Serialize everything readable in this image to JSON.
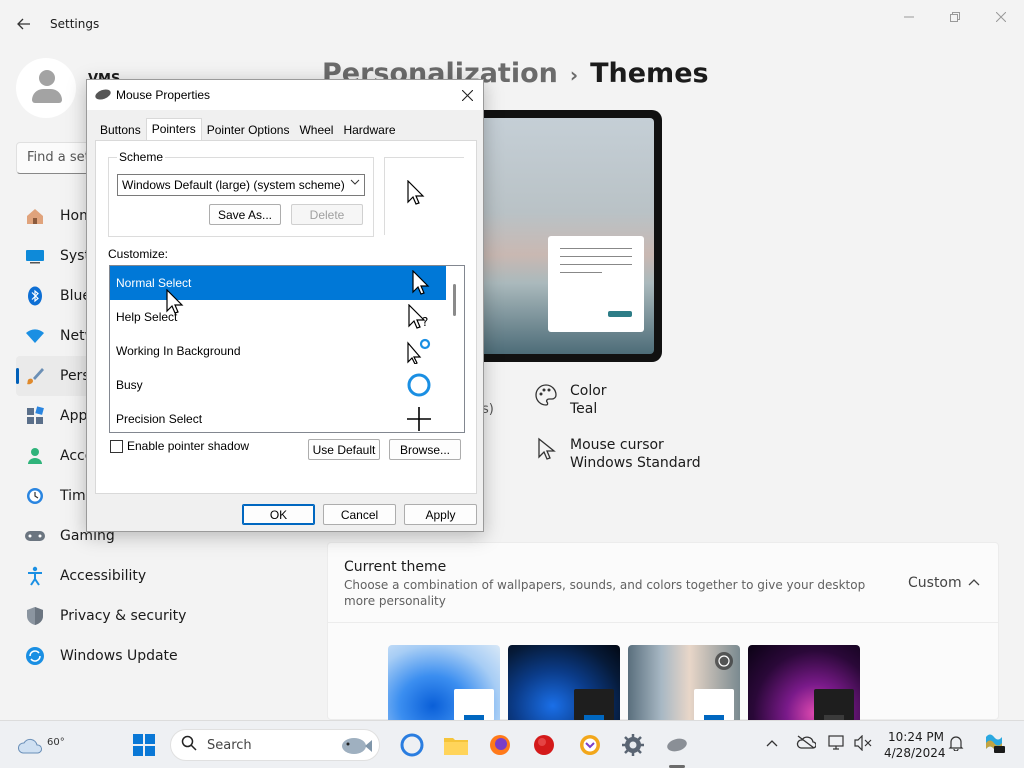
{
  "settings": {
    "app_title": "Settings",
    "username": "VMS",
    "search_placeholder": "Find a set",
    "nav": [
      {
        "label": "Hom",
        "icon": "home-icon"
      },
      {
        "label": "Syste",
        "icon": "system-icon"
      },
      {
        "label": "Blue",
        "icon": "bluetooth-icon"
      },
      {
        "label": "Netw",
        "icon": "network-icon"
      },
      {
        "label": "Pers",
        "icon": "personalization-icon",
        "active": true
      },
      {
        "label": "App",
        "icon": "apps-icon"
      },
      {
        "label": "Acco",
        "icon": "accounts-icon"
      },
      {
        "label": "Time",
        "icon": "time-icon"
      },
      {
        "label": "Gaming",
        "icon": "gaming-icon"
      },
      {
        "label": "Accessibility",
        "icon": "accessibility-icon"
      },
      {
        "label": "Privacy & security",
        "icon": "shield-icon"
      },
      {
        "label": "Windows Update",
        "icon": "update-icon"
      }
    ],
    "breadcrumb": {
      "parent": "Personalization",
      "separator": "›",
      "current": "Themes"
    },
    "stray_text": "s)",
    "properties": [
      {
        "title": "Color",
        "value": "Teal",
        "icon": "palette-icon"
      },
      {
        "title": "Mouse cursor",
        "value": "Windows Standard",
        "icon": "mouse-cursor-icon"
      }
    ],
    "current_theme": {
      "title": "Current theme",
      "description": "Choose a combination of wallpapers, sounds, and colors together to give your desktop more personality",
      "value": "Custom",
      "chevron": "^"
    }
  },
  "mouse_dialog": {
    "title": "Mouse Properties",
    "tabs": [
      "Buttons",
      "Pointers",
      "Pointer Options",
      "Wheel",
      "Hardware"
    ],
    "active_tab": "Pointers",
    "scheme_label": "Scheme",
    "scheme_value": "Windows Default (large) (system scheme)",
    "save_as_label": "Save As...",
    "delete_label": "Delete",
    "customize_label": "Customize:",
    "cursor_items": [
      {
        "label": "Normal Select",
        "selected": true,
        "icon": "arrow-cursor-icon"
      },
      {
        "label": "Help Select",
        "selected": false,
        "icon": "help-cursor-icon"
      },
      {
        "label": "Working In Background",
        "selected": false,
        "icon": "working-cursor-icon"
      },
      {
        "label": "Busy",
        "selected": false,
        "icon": "busy-cursor-icon"
      },
      {
        "label": "Precision Select",
        "selected": false,
        "icon": "crosshair-cursor-icon"
      }
    ],
    "enable_shadow_label": "Enable pointer shadow",
    "enable_shadow_checked": false,
    "use_default_label": "Use Default",
    "browse_label": "Browse...",
    "ok_label": "OK",
    "cancel_label": "Cancel",
    "apply_label": "Apply"
  },
  "taskbar": {
    "weather_temp": "60°",
    "search_label": "Search",
    "time": "10:24 PM",
    "date": "4/28/2024"
  },
  "colors": {
    "accent": "#0078d7",
    "teal": "#2d7d87"
  }
}
